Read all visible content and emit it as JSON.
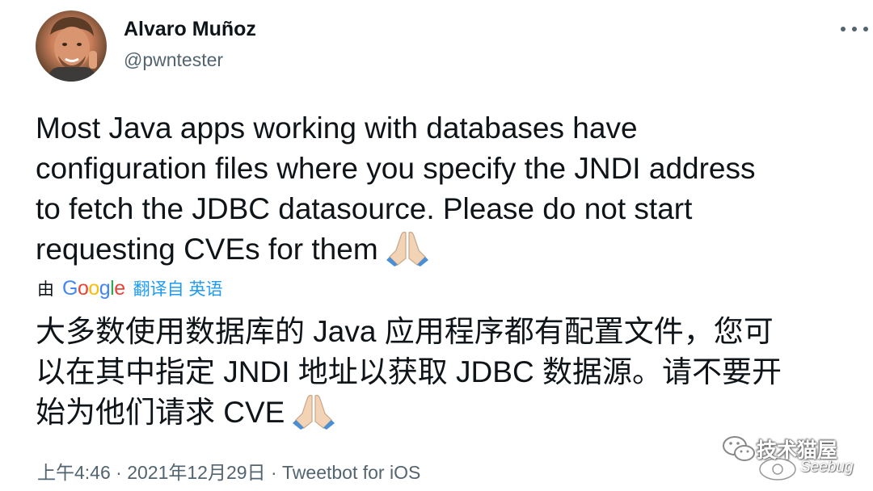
{
  "author": {
    "display_name": "Alvaro Muñoz",
    "handle": "@pwntester"
  },
  "tweet": {
    "text_lines": [
      "Most Java apps working with databases have",
      "configuration files where you specify the JNDI address",
      "to fetch the JDBC datasource. Please do not start",
      "requesting CVEs for them"
    ],
    "emoji": "folded-hands"
  },
  "translation": {
    "prefix": "由",
    "provider_letters": [
      "G",
      "o",
      "o",
      "g",
      "l",
      "e"
    ],
    "provider_colors": [
      "#4285f4",
      "#ea4335",
      "#fbbc05",
      "#4285f4",
      "#34a853",
      "#ea4335"
    ],
    "from_label": "翻译自 英语",
    "text_lines": [
      "大多数使用数据库的 Java 应用程序都有配置文件，您可",
      "以在其中指定 JNDI 地址以获取 JDBC 数据源。请不要开",
      "始为他们请求 CVE"
    ]
  },
  "meta": {
    "time": "上午4:46",
    "separator": "·",
    "date": "2021年12月29日",
    "source": "Tweetbot for iOS"
  },
  "watermark": {
    "title": "技术猫屋",
    "subtitle": "Seebug"
  },
  "colors": {
    "text": "#0f1419",
    "secondary": "#536471",
    "link": "#1d9bf0"
  }
}
